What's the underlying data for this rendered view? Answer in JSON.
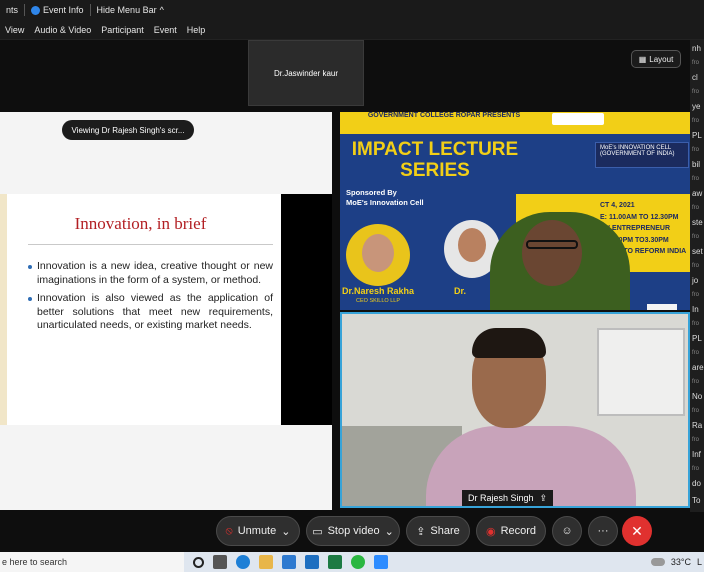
{
  "topbar": {
    "participants": "nts",
    "event_info": "Event Info",
    "hide_menu": "Hide Menu Bar",
    "chevron": "^"
  },
  "menu": [
    "View",
    "Audio & Video",
    "Participant",
    "Event",
    "Help"
  ],
  "tile_top": {
    "name": "Dr.Jaswinder kaur"
  },
  "layout_button": "Layout",
  "share": {
    "viewing_label": "Viewing Dr Rajesh Singh's scr...",
    "slide_title": "Innovation, in brief",
    "bullets": [
      "Innovation is a new idea, creative thought or new imaginations in the form of a system, or method.",
      "Innovation is also viewed as the application of better solutions that meet new requirements, unarticulated needs, or existing market needs."
    ]
  },
  "poster": {
    "college": "GOVERNMENT COLLEGE ROPAR PRESENTS",
    "impact_line1": "IMPACT LECTURE",
    "impact_line2": "SERIES",
    "sponsored_by": "Sponsored By",
    "sponsor": "MoE's Innovation Cell",
    "cell_name": "MoE's INNOVATION CELL",
    "cell_sub": "(GOVERNMENT OF INDIA)",
    "date_line": "CT 4, 2021",
    "time_line1": "E: 11.00AM TO 12.30PM",
    "role_line": "AN ENTREPRENEUR",
    "time_line2": "E: 2.00PM TO3.30PM",
    "topic_line": "IDEAS TO REFORM INDIA",
    "speaker1_name": "Dr.Naresh Rakha",
    "speaker1_role": "CEO SKILLO LLP",
    "speaker2_name": "Dr."
  },
  "camera": {
    "name": "Dr Rajesh Singh"
  },
  "chat": [
    {
      "text": "nh",
      "meta": "fro"
    },
    {
      "text": "cl",
      "meta": "fro"
    },
    {
      "text": "ye",
      "meta": "fro"
    },
    {
      "text": "PL",
      "meta": "fro"
    },
    {
      "text": "bil",
      "meta": "fro"
    },
    {
      "text": "aw",
      "meta": "fro"
    },
    {
      "text": "ste",
      "meta": "fro"
    },
    {
      "text": "set",
      "meta": "fro"
    },
    {
      "text": "jo",
      "meta": "fro"
    },
    {
      "text": "In",
      "meta": "fro"
    },
    {
      "text": "PL",
      "meta": "fro"
    },
    {
      "text": "are",
      "meta": "fro"
    },
    {
      "text": "No",
      "meta": "fro"
    },
    {
      "text": "Ra",
      "meta": "fro"
    },
    {
      "text": "Inf",
      "meta": "fro"
    },
    {
      "text": "do",
      "meta": ""
    }
  ],
  "chat_footer": "To",
  "controls": {
    "unmute": "Unmute",
    "stop_video": "Stop video",
    "share": "Share",
    "record": "Record"
  },
  "taskbar": {
    "search": "e here to search",
    "temp": "33°C",
    "tray_extra": "L"
  }
}
